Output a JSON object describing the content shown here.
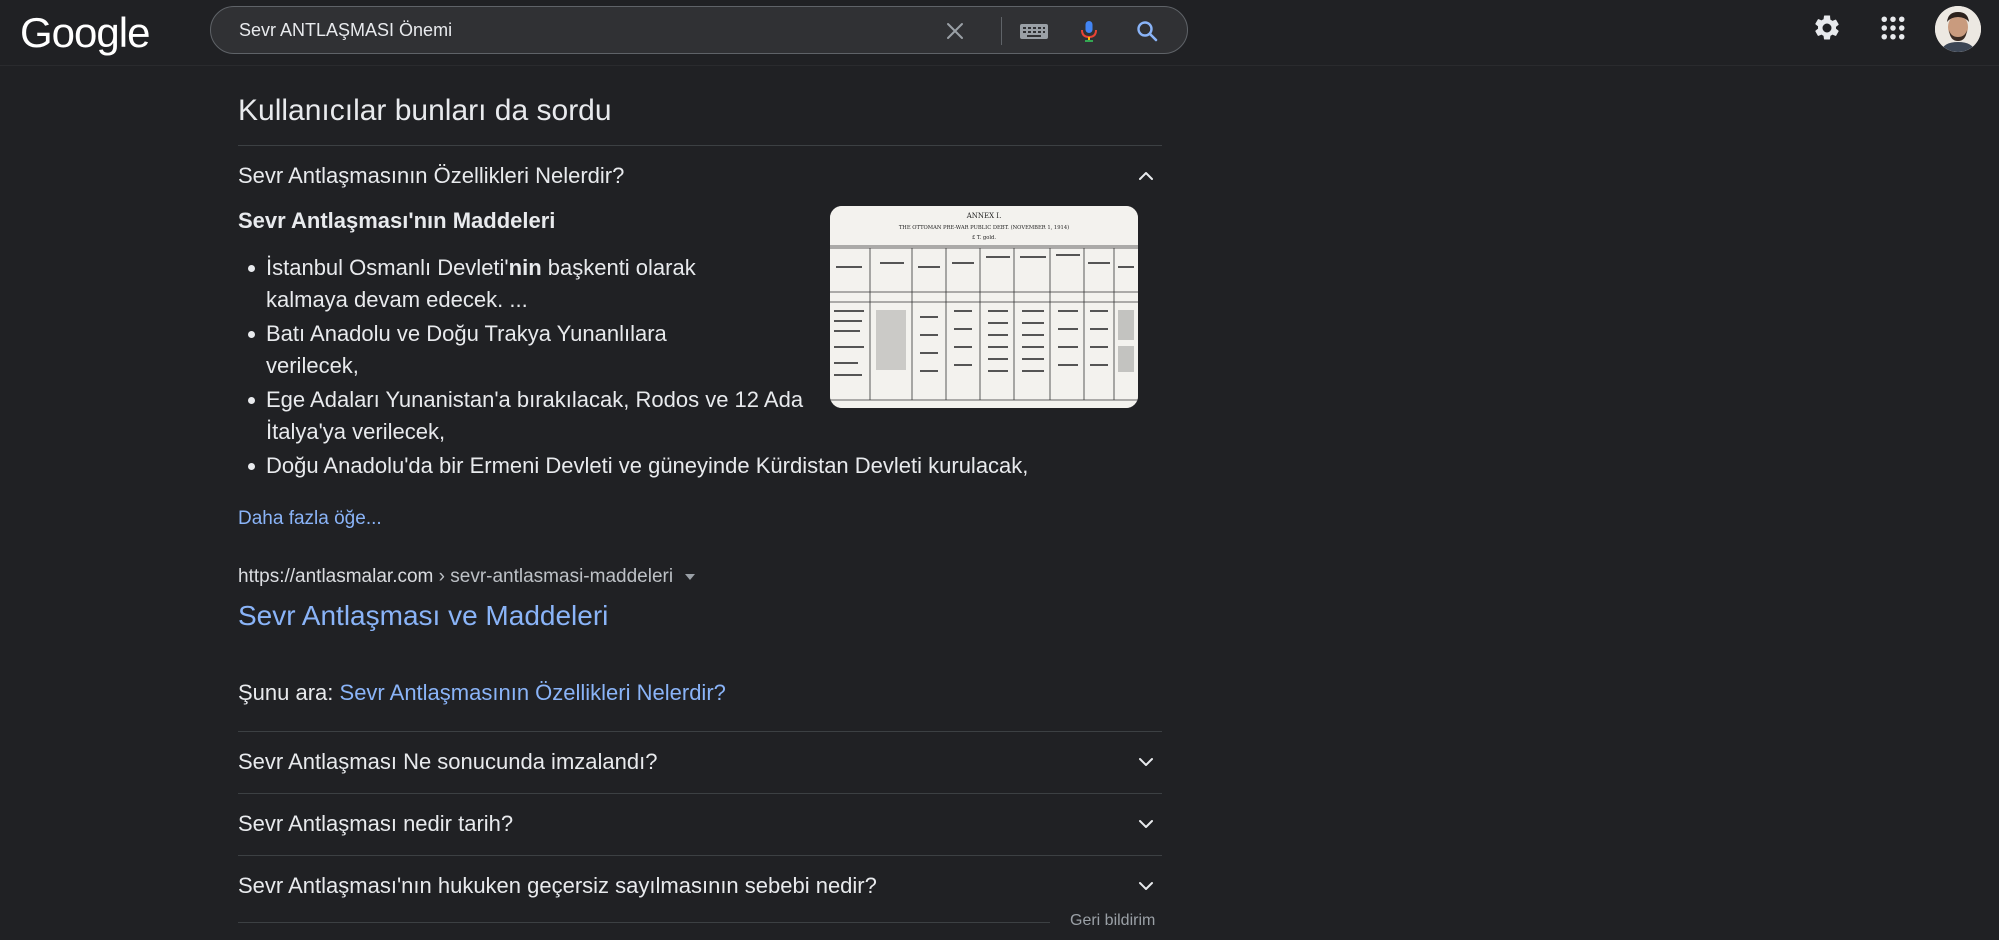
{
  "header": {
    "logo_text": "Google",
    "search": {
      "value": "Sevr ANTLAŞMASI Önemi"
    },
    "icons": {
      "clear": "close-icon",
      "keyboard": "keyboard-icon",
      "voice": "microphone-icon",
      "search": "search-icon",
      "settings": "gear-icon",
      "apps": "apps-grid-icon"
    }
  },
  "paa": {
    "title": "Kullanıcılar bunları da sordu",
    "expanded": {
      "question": "Sevr Antlaşmasının Özellikleri Nelerdir?",
      "answer_heading": "Sevr Antlaşması'nın Maddeleri",
      "bullets": [
        {
          "pre": "İstanbul Osmanlı Devleti'",
          "bold": "nin",
          "post": " başkenti olarak kalmaya devam edecek. ..."
        },
        {
          "text": "Batı Anadolu ve Doğu Trakya Yunanlılara verilecek,"
        },
        {
          "text": "Ege Adaları Yunanistan'a bırakılacak, Rodos ve 12 Ada İtalya'ya verilecek,"
        },
        {
          "text": "Doğu Anadolu'da bir Ermeni Devleti ve güneyinde Kürdistan Devleti kurulacak,"
        }
      ],
      "image": {
        "caption_line1": "ANNEX I.",
        "caption_line2": "THE OTTOMAN PRE-WAR PUBLIC DEBT. (NOVEMBER 1, 1914)",
        "caption_line3": "£ T. gold."
      },
      "more_link": "Daha fazla öğe...",
      "source": {
        "domain": "https://antlasmalar.com",
        "path": " › sevr-antlasmasi-maddeleri",
        "title": "Sevr Antlaşması ve Maddeleri"
      },
      "search_for_label": "Şunu ara: ",
      "search_for_link": "Sevr Antlaşmasının Özellikleri Nelerdir?"
    },
    "questions": [
      "Sevr Antlaşması Ne sonucunda imzalandı?",
      "Sevr Antlaşması nedir tarih?",
      "Sevr Antlaşması'nın hukuken geçersiz sayılmasının sebebi nedir?"
    ],
    "feedback": "Geri bildirim"
  },
  "colors": {
    "background": "#202124",
    "link": "#8ab4f8",
    "text": "#e8eaed",
    "divider": "#3c4043"
  }
}
